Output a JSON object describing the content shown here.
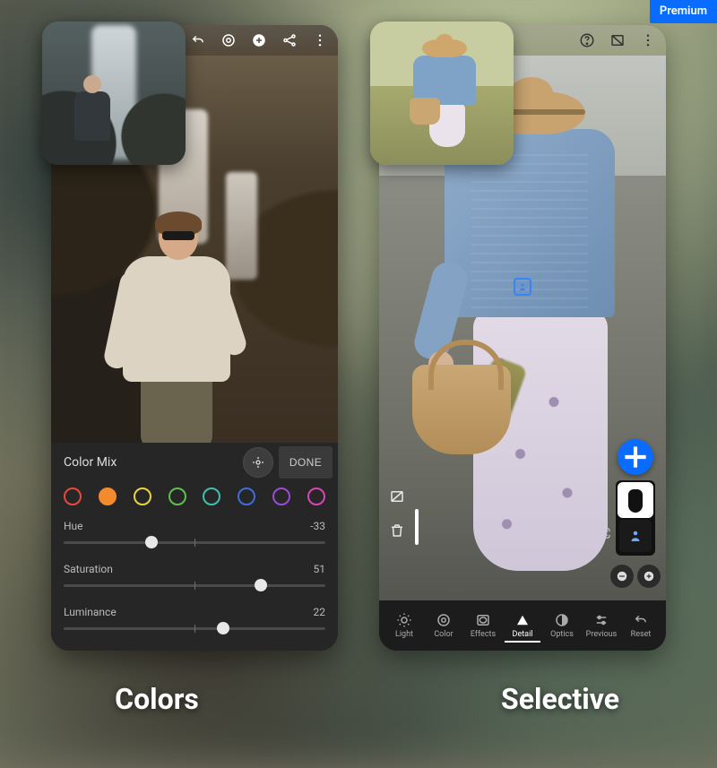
{
  "premium_label": "Premium",
  "captions": {
    "left": "Colors",
    "right": "Selective"
  },
  "phone1": {
    "topbar_icons": [
      "undo-icon",
      "lens-icon",
      "add-icon",
      "share-icon",
      "more-icon"
    ],
    "panel": {
      "title": "Color Mix",
      "done_label": "DONE",
      "swatches": [
        {
          "color": "#e9483a",
          "selected": false
        },
        {
          "color": "#f28b2d",
          "selected": true
        },
        {
          "color": "#e8d63a",
          "selected": false
        },
        {
          "color": "#5fbf4b",
          "selected": false
        },
        {
          "color": "#3fbfae",
          "selected": false
        },
        {
          "color": "#3f6bdc",
          "selected": false
        },
        {
          "color": "#9a4bd8",
          "selected": false
        },
        {
          "color": "#d944b4",
          "selected": false
        }
      ],
      "sliders": {
        "hue": {
          "label": "Hue",
          "value": -33,
          "min": -100,
          "max": 100
        },
        "saturation": {
          "label": "Saturation",
          "value": 51,
          "min": -100,
          "max": 100
        },
        "luminance": {
          "label": "Luminance",
          "value": 22,
          "min": -100,
          "max": 100
        }
      }
    }
  },
  "phone2": {
    "topbar_icons": [
      "help-icon",
      "compare-icon",
      "more-icon"
    ],
    "side_tools": {
      "compare": "compare-icon",
      "delete": "trash-icon"
    },
    "fab_icon": "plus-icon",
    "toolbar": [
      {
        "id": "light",
        "label": "Light",
        "icon": "brightness-icon",
        "active": false
      },
      {
        "id": "color",
        "label": "Color",
        "icon": "palette-icon",
        "active": false
      },
      {
        "id": "effects",
        "label": "Effects",
        "icon": "vignette-icon",
        "active": false
      },
      {
        "id": "detail",
        "label": "Detail",
        "icon": "triangle-icon",
        "active": true
      },
      {
        "id": "optics",
        "label": "Optics",
        "icon": "lens-icon",
        "active": false
      },
      {
        "id": "previous",
        "label": "Previous",
        "icon": "sliders-icon",
        "active": false
      },
      {
        "id": "reset",
        "label": "Reset",
        "icon": "undo-icon",
        "active": false
      }
    ]
  }
}
